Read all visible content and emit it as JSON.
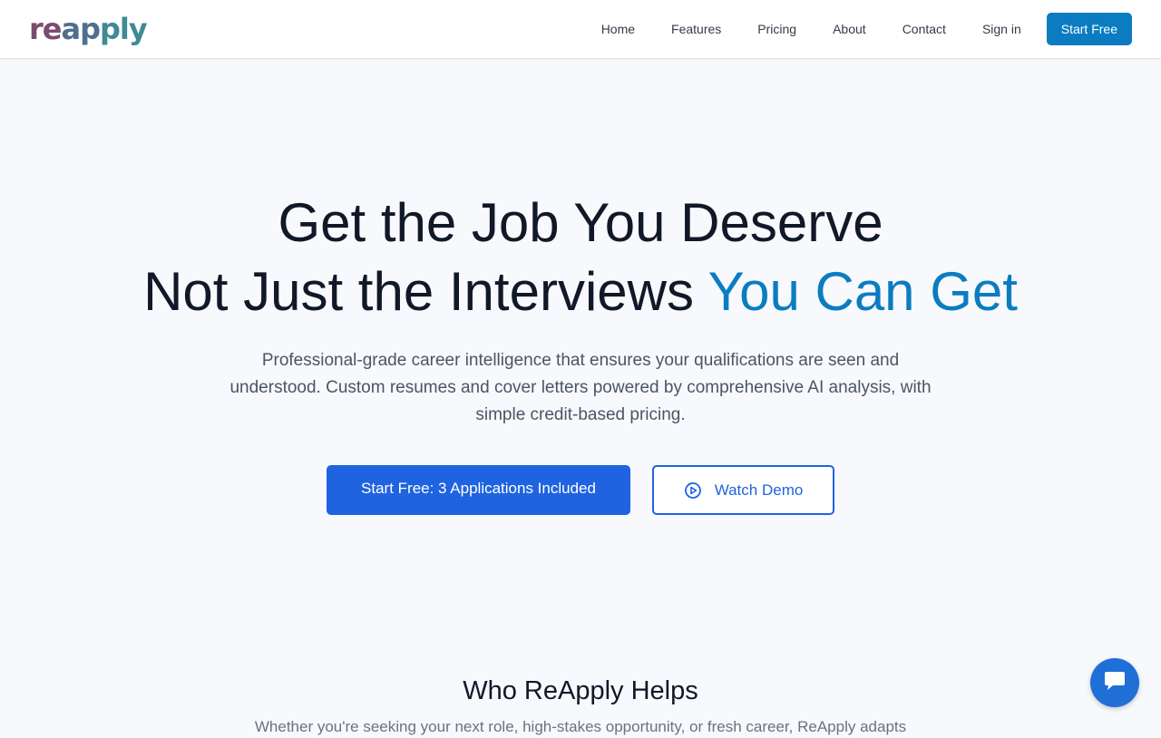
{
  "header": {
    "logo": {
      "part1": "re",
      "part2": "ap",
      "part3": "ply"
    },
    "nav": [
      {
        "label": "Home"
      },
      {
        "label": "Features"
      },
      {
        "label": "Pricing"
      },
      {
        "label": "About"
      },
      {
        "label": "Contact"
      },
      {
        "label": "Sign in"
      }
    ],
    "cta_label": "Start Free"
  },
  "hero": {
    "title_line1": "Get the Job You Deserve",
    "title_line2_prefix": "Not Just the Interviews ",
    "title_line2_accent": "You Can Get",
    "subtitle": "Professional-grade career intelligence that ensures your qualifications are seen and understood. Custom resumes and cover letters powered by comprehensive AI analysis, with simple credit-based pricing.",
    "primary_button": "Start Free: 3 Applications Included",
    "secondary_button": "Watch Demo"
  },
  "section": {
    "title": "Who ReApply Helps",
    "subtitle": "Whether you're seeking your next role, high-stakes opportunity, or fresh career, ReApply adapts"
  },
  "icons": {
    "play": "play-circle-icon",
    "chat": "chat-bubble-icon"
  },
  "colors": {
    "accent": "#0b7cc1",
    "primary_button": "#1f63e0",
    "chat_button": "#1f6fd6",
    "background": "#f7f9fc"
  }
}
